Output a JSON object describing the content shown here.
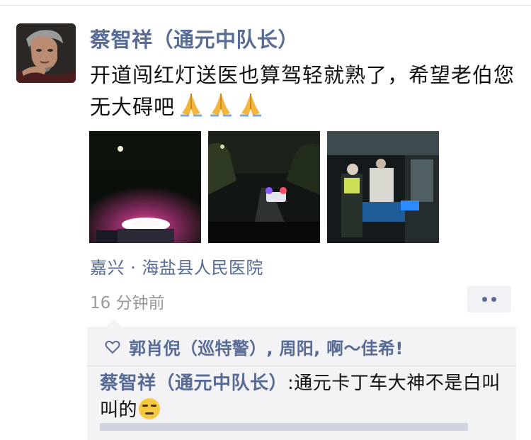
{
  "post": {
    "author": "蔡智祥（通元中队长）",
    "text": "开道闯红灯送医也算驾轻就熟了，希望老伯您无大碍吧",
    "emoji": [
      "folded-hands-emoji",
      "folded-hands-emoji",
      "folded-hands-emoji"
    ],
    "photos": [
      {
        "name": "night-police-car-photo"
      },
      {
        "name": "night-road-photo"
      },
      {
        "name": "hospital-entrance-photo"
      }
    ],
    "location": "嘉兴 · 海盐县人民医院",
    "time": "16 分钟前"
  },
  "likes": {
    "names": "郭肖倪（巡特警）, 周阳, 啊～佳希!"
  },
  "comments": [
    {
      "author": "蔡智祥（通元中队长）",
      "separator": ":",
      "text": "通元卡丁车大神不是白叫叫的",
      "emoji": "smirk-emoji"
    }
  ],
  "colors": {
    "link": "#576b95",
    "text": "#111111",
    "muted": "#999999",
    "comment_bg": "#f3f3f5"
  }
}
